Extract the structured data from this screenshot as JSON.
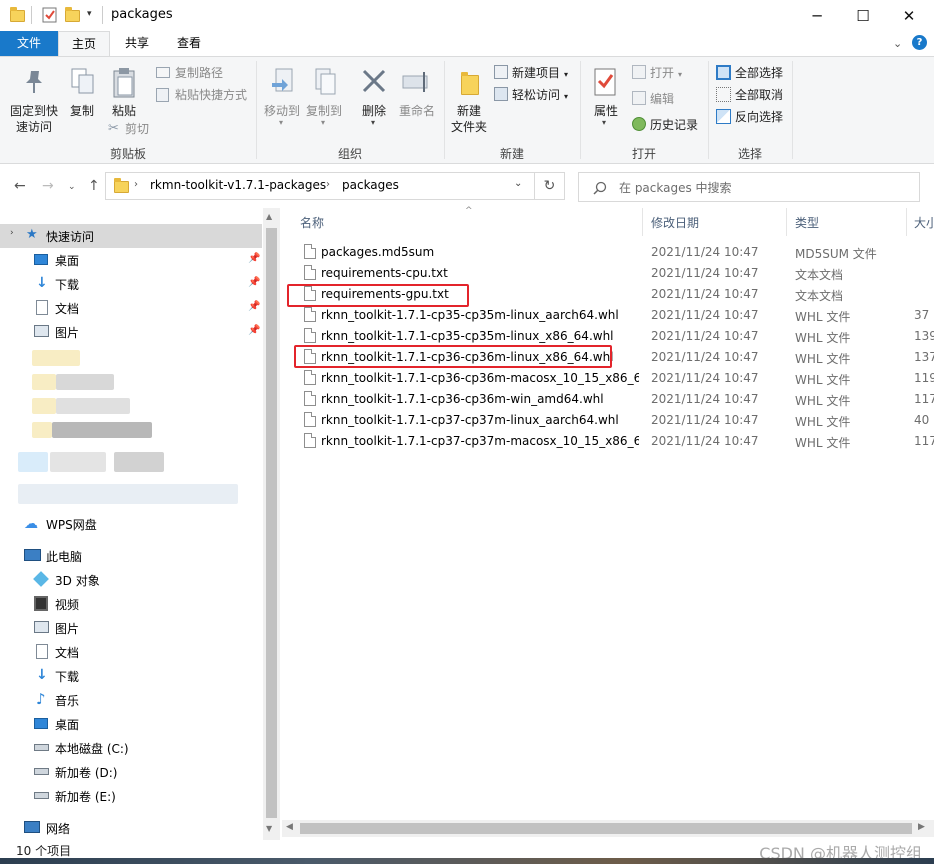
{
  "window": {
    "title": "packages",
    "minimize": "─",
    "maximize": "☐",
    "close": "✕"
  },
  "tabs": [
    "文件",
    "主页",
    "共享",
    "查看"
  ],
  "ribbon": {
    "clipboard": {
      "group": "剪贴板",
      "pin_line1": "固定到快",
      "pin_line2": "速访问",
      "copy": "复制",
      "paste": "粘贴",
      "copy_path": "复制路径",
      "paste_shortcut": "粘贴快捷方式",
      "cut": "剪切"
    },
    "organize": {
      "group": "组织",
      "move_to": "移动到",
      "copy_to": "复制到",
      "delete": "删除",
      "rename": "重命名"
    },
    "new": {
      "group": "新建",
      "new_folder_1": "新建",
      "new_folder_2": "文件夹",
      "new_item": "新建项目",
      "easy_access": "轻松访问"
    },
    "open": {
      "group": "打开",
      "properties": "属性",
      "open": "打开",
      "edit": "编辑",
      "history": "历史记录"
    },
    "select": {
      "group": "选择",
      "select_all": "全部选择",
      "select_none": "全部取消",
      "invert": "反向选择"
    }
  },
  "address": {
    "crumb1": "rkmn-toolkit-v1.7.1-packages",
    "crumb2": "packages",
    "search_placeholder": "在 packages 中搜索"
  },
  "sidebar": {
    "quick_access": "快速访问",
    "qa_items": [
      "桌面",
      "下载",
      "文档",
      "图片"
    ],
    "wps": "WPS网盘",
    "this_pc": "此电脑",
    "pc_items": [
      "3D 对象",
      "视频",
      "图片",
      "文档",
      "下载",
      "音乐",
      "桌面",
      "本地磁盘 (C:)",
      "新加卷 (D:)",
      "新加卷 (E:)"
    ],
    "network": "网络"
  },
  "columns": {
    "name": "名称",
    "date": "修改日期",
    "type": "类型",
    "size": "大小"
  },
  "files": [
    {
      "name": "packages.md5sum",
      "date": "2021/11/24 10:47",
      "type": "MD5SUM 文件",
      "size": ""
    },
    {
      "name": "requirements-cpu.txt",
      "date": "2021/11/24 10:47",
      "type": "文本文档",
      "size": ""
    },
    {
      "name": "requirements-gpu.txt",
      "date": "2021/11/24 10:47",
      "type": "文本文档",
      "size": ""
    },
    {
      "name": "rknn_toolkit-1.7.1-cp35-cp35m-linux_aarch64.whl",
      "date": "2021/11/24 10:47",
      "type": "WHL 文件",
      "size": "37"
    },
    {
      "name": "rknn_toolkit-1.7.1-cp35-cp35m-linux_x86_64.whl",
      "date": "2021/11/24 10:47",
      "type": "WHL 文件",
      "size": "139"
    },
    {
      "name": "rknn_toolkit-1.7.1-cp36-cp36m-linux_x86_64.whl",
      "date": "2021/11/24 10:47",
      "type": "WHL 文件",
      "size": "137"
    },
    {
      "name": "rknn_toolkit-1.7.1-cp36-cp36m-macosx_10_15_x86_6...",
      "date": "2021/11/24 10:47",
      "type": "WHL 文件",
      "size": "119"
    },
    {
      "name": "rknn_toolkit-1.7.1-cp36-cp36m-win_amd64.whl",
      "date": "2021/11/24 10:47",
      "type": "WHL 文件",
      "size": "117"
    },
    {
      "name": "rknn_toolkit-1.7.1-cp37-cp37m-linux_aarch64.whl",
      "date": "2021/11/24 10:47",
      "type": "WHL 文件",
      "size": "40"
    },
    {
      "name": "rknn_toolkit-1.7.1-cp37-cp37m-macosx_10_15_x86_6...",
      "date": "2021/11/24 10:47",
      "type": "WHL 文件",
      "size": "117"
    }
  ],
  "status": {
    "count": "10 个项目",
    "watermark": "CSDN @机器人测控组"
  },
  "colors": {
    "accent": "#1979ca",
    "highlight": "#e3242b",
    "folder": "#f7d35b"
  }
}
